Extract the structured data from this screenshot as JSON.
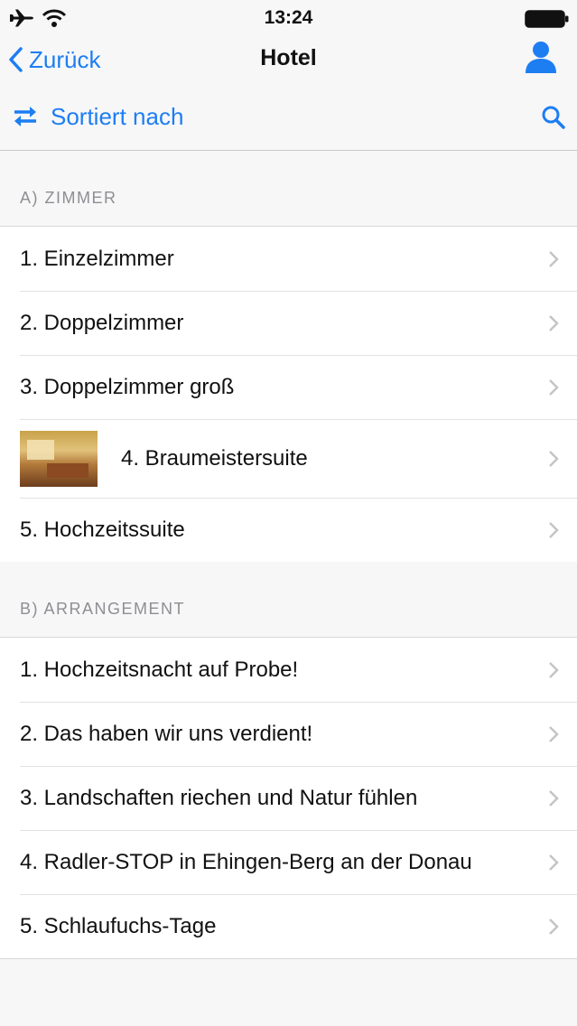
{
  "status": {
    "time": "13:24"
  },
  "nav": {
    "back_label": "Zurück",
    "title": "Hotel"
  },
  "toolbar": {
    "sort_label": "Sortiert nach"
  },
  "sections": [
    {
      "header": "A) ZIMMER",
      "items": [
        {
          "label": "1. Einzelzimmer"
        },
        {
          "label": "2. Doppelzimmer"
        },
        {
          "label": "3. Doppelzimmer groß"
        },
        {
          "label": "4. Braumeistersuite"
        },
        {
          "label": "5. Hochzeitssuite"
        }
      ]
    },
    {
      "header": "B) ARRANGEMENT",
      "items": [
        {
          "label": "1. Hochzeitsnacht auf Probe!"
        },
        {
          "label": "2. Das haben wir uns verdient!"
        },
        {
          "label": "3. Landschaften riechen und Natur fühlen"
        },
        {
          "label": "4. Radler-STOP in Ehingen-Berg an der Donau"
        },
        {
          "label": "5. Schlaufuchs-Tage"
        }
      ]
    }
  ],
  "colors": {
    "accent": "#1d7ef2",
    "background": "#f7f7f8",
    "header_text": "#8e8e93"
  }
}
